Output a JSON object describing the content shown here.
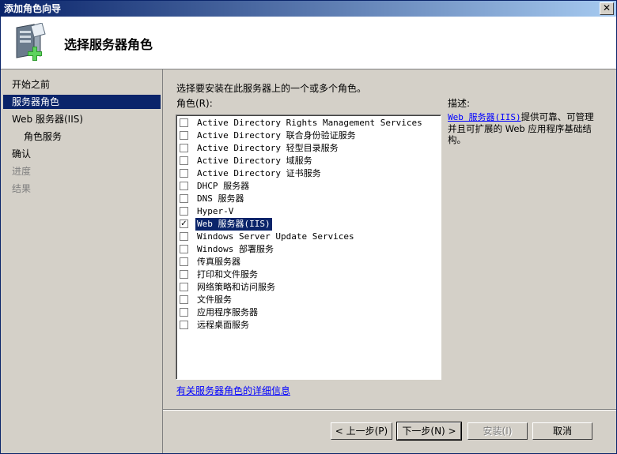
{
  "window": {
    "title": "添加角色向导",
    "close_label": "✕"
  },
  "header": {
    "title": "选择服务器角色"
  },
  "sidebar": {
    "items": [
      {
        "label": "开始之前",
        "state": "normal"
      },
      {
        "label": "服务器角色",
        "state": "selected"
      },
      {
        "label": "Web 服务器(IIS)",
        "state": "normal"
      },
      {
        "label": "角色服务",
        "state": "normal"
      },
      {
        "label": "确认",
        "state": "normal"
      },
      {
        "label": "进度",
        "state": "disabled"
      },
      {
        "label": "结果",
        "state": "disabled"
      }
    ]
  },
  "main": {
    "instruction": "选择要安装在此服务器上的一个或多个角色。",
    "roles_label": "角色(R):",
    "roles": [
      {
        "label": "Active Directory Rights Management Services",
        "checked": false
      },
      {
        "label": "Active Directory 联合身份验证服务",
        "checked": false
      },
      {
        "label": "Active Directory 轻型目录服务",
        "checked": false
      },
      {
        "label": "Active Directory 域服务",
        "checked": false
      },
      {
        "label": "Active Directory 证书服务",
        "checked": false
      },
      {
        "label": "DHCP 服务器",
        "checked": false
      },
      {
        "label": "DNS 服务器",
        "checked": false
      },
      {
        "label": "Hyper-V",
        "checked": false
      },
      {
        "label": "Web 服务器(IIS)",
        "checked": true,
        "selected": true
      },
      {
        "label": "Windows Server Update Services",
        "checked": false
      },
      {
        "label": "Windows 部署服务",
        "checked": false
      },
      {
        "label": "传真服务器",
        "checked": false
      },
      {
        "label": "打印和文件服务",
        "checked": false
      },
      {
        "label": "网络策略和访问服务",
        "checked": false
      },
      {
        "label": "文件服务",
        "checked": false
      },
      {
        "label": "应用程序服务器",
        "checked": false
      },
      {
        "label": "远程桌面服务",
        "checked": false
      }
    ],
    "description_title": "描述:",
    "description_link": "Web 服务器(IIS)",
    "description_text": "提供可靠、可管理并且可扩展的 Web 应用程序基础结构。",
    "more_info_link": "有关服务器角色的详细信息"
  },
  "buttons": {
    "back": "< 上一步(P)",
    "next": "下一步(N) >",
    "install": "安装(I)",
    "cancel": "取消"
  },
  "colors": {
    "selection": "#0a246a",
    "link": "#0000ff",
    "dialog_bg": "#d4d0c8"
  }
}
